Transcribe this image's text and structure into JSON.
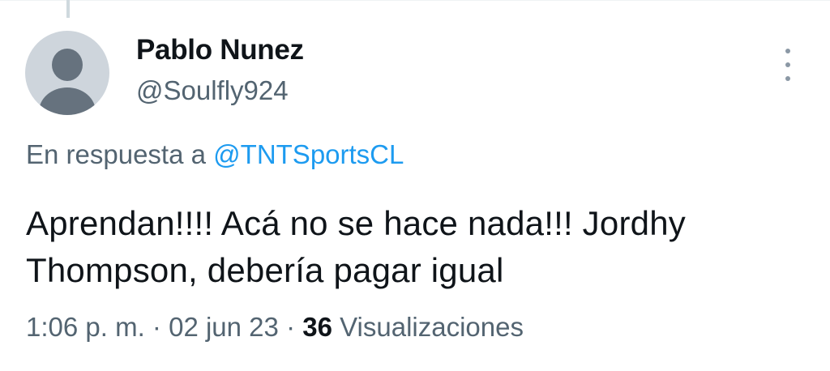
{
  "tweet": {
    "author": {
      "name": "Pablo Nunez",
      "handle": "@Soulfly924"
    },
    "reply_to": {
      "prefix": "En respuesta a",
      "mention": "@TNTSportsCL"
    },
    "text_line1": "Aprendan!!!! Acá no se hace nada!!! Jordhy",
    "text_line2": "Thompson, debería pagar igual",
    "meta": {
      "time": "1:06 p. m.",
      "separator": "·",
      "date": "02 jun 23",
      "views_count": "36",
      "views_label": "Visualizaciones"
    }
  },
  "colors": {
    "text_primary": "#0f1419",
    "text_secondary": "#536471",
    "accent": "#1d9bf0",
    "avatar_bg": "#ced5dc",
    "avatar_fg": "#66727e"
  },
  "icons": {
    "more": "more-vertical-icon",
    "avatar": "default-avatar-icon"
  }
}
